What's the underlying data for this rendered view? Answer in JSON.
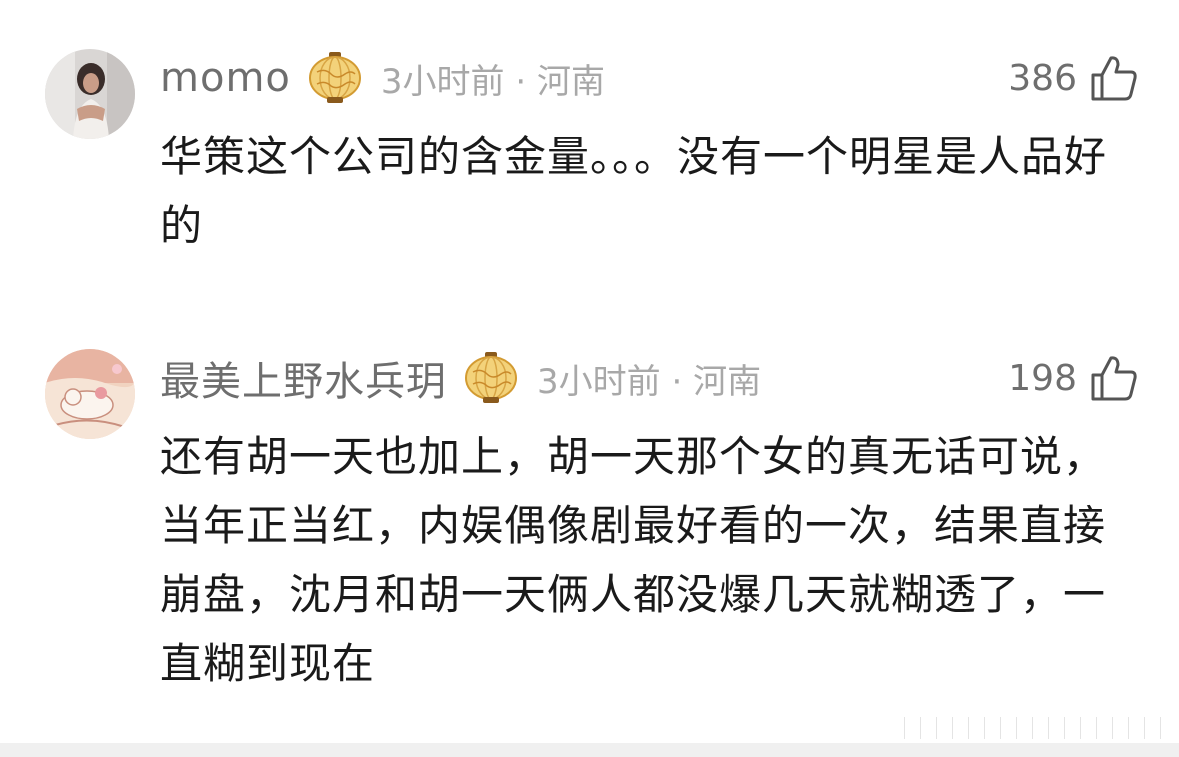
{
  "comments": [
    {
      "username": "momo",
      "time": "3小时前",
      "separator": "·",
      "location": "河南",
      "likes": "386",
      "text": "华策这个公司的含金量。。。没有一个明星是人品好的",
      "badge_icon": "lantern-badge-icon",
      "like_icon": "thumbs-up-icon"
    },
    {
      "username": "最美上野水兵玥",
      "time": "3小时前",
      "separator": "·",
      "location": "河南",
      "likes": "198",
      "text": "还有胡一天也加上，胡一天那个女的真无话可说，当年正当红，内娱偶像剧最好看的一次，结果直接崩盘，沈月和胡一天俩人都没爆几天就糊透了，一直糊到现在",
      "badge_icon": "lantern-badge-icon",
      "like_icon": "thumbs-up-icon"
    }
  ],
  "colors": {
    "username": "#6e6e6e",
    "meta": "#a8a8a8",
    "text": "#1a1a1a",
    "badge_gold": "#e8b64a"
  }
}
